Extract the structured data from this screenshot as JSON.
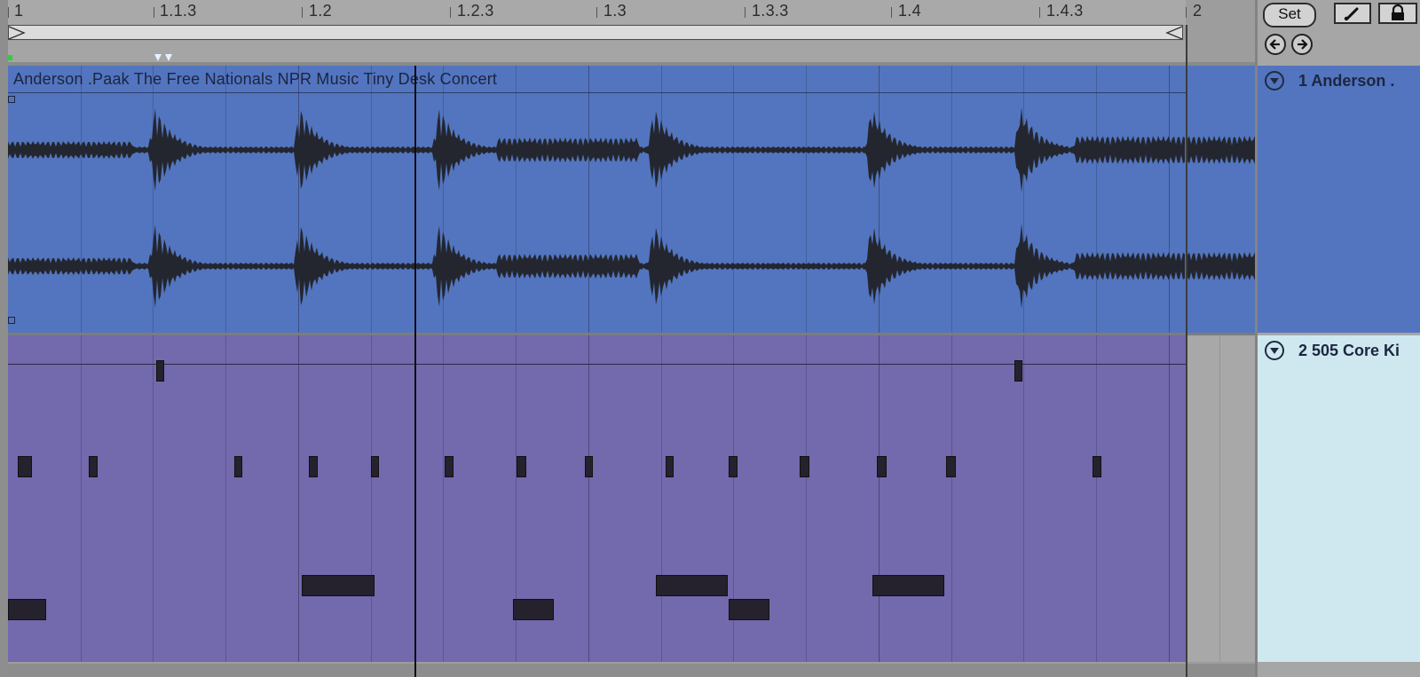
{
  "ruler": {
    "labels": [
      "1",
      "1.1.3",
      "1.2",
      "1.2.3",
      "1.3",
      "1.3.3",
      "1.4",
      "1.4.3",
      "2"
    ]
  },
  "transport": {
    "set_label": "Set"
  },
  "tracks": [
    {
      "name": "1 Anderson .",
      "clip_title": "Anderson .Paak  The Free Nationals NPR Music Tiny Desk Concert",
      "color": "#5375bf"
    },
    {
      "name": "2 505 Core Ki",
      "color": "#7369ad"
    }
  ],
  "icons": {
    "draw_mode": "pencil-icon",
    "lock": "lock-icon",
    "nav_back": "arrow-left-icon",
    "nav_forward": "arrow-right-icon",
    "fold": "fold-triangle-icon"
  }
}
